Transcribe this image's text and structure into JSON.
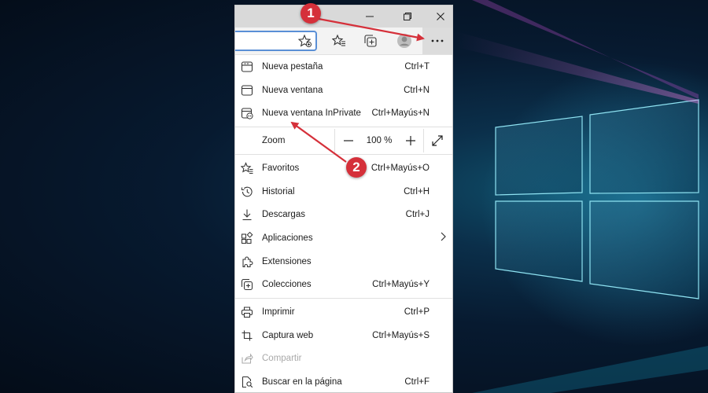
{
  "browser": {
    "window_buttons": [
      "minimize-icon",
      "restore-icon",
      "close-icon"
    ],
    "toolbar_icons": [
      "favorite-star-icon",
      "favorites-list-icon",
      "collections-icon",
      "profile-icon",
      "more-icon"
    ]
  },
  "menu": {
    "group1": [
      {
        "label": "Nueva pestaña",
        "shortcut": "Ctrl+T",
        "icon": "new-tab-icon"
      },
      {
        "label": "Nueva ventana",
        "shortcut": "Ctrl+N",
        "icon": "new-window-icon"
      },
      {
        "label": "Nueva ventana InPrivate",
        "shortcut": "Ctrl+Mayús+N",
        "icon": "inprivate-icon"
      }
    ],
    "zoom": {
      "label": "Zoom",
      "value": "100 %"
    },
    "group2": [
      {
        "label": "Favoritos",
        "shortcut": "Ctrl+Mayús+O",
        "icon": "favorites-icon"
      },
      {
        "label": "Historial",
        "shortcut": "Ctrl+H",
        "icon": "history-icon"
      },
      {
        "label": "Descargas",
        "shortcut": "Ctrl+J",
        "icon": "download-icon"
      },
      {
        "label": "Aplicaciones",
        "shortcut": "",
        "icon": "apps-icon"
      },
      {
        "label": "Extensiones",
        "shortcut": "",
        "icon": "extensions-icon"
      },
      {
        "label": "Colecciones",
        "shortcut": "Ctrl+Mayús+Y",
        "icon": "collections-icon"
      }
    ],
    "group3": [
      {
        "label": "Imprimir",
        "shortcut": "Ctrl+P",
        "icon": "print-icon"
      },
      {
        "label": "Captura web",
        "shortcut": "Ctrl+Mayús+S",
        "icon": "web-capture-icon"
      },
      {
        "label": "Compartir",
        "shortcut": "",
        "icon": "share-icon",
        "disabled": true
      },
      {
        "label": "Buscar en la página",
        "shortcut": "Ctrl+F",
        "icon": "find-icon"
      }
    ]
  },
  "annotations": [
    {
      "number": "1"
    },
    {
      "number": "2"
    }
  ],
  "colors": {
    "accent": "#d5303a",
    "address_border": "#5a8fd6"
  }
}
